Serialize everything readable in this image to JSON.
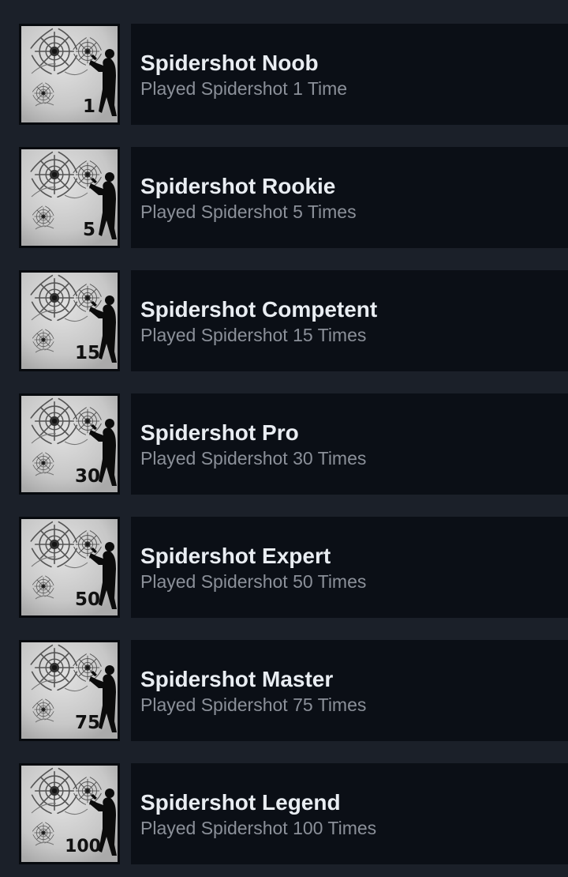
{
  "achievements": [
    {
      "title": "Spidershot Noob",
      "description": "Played Spidershot 1 Time",
      "badge_number": "1",
      "icon": "spidershot-achievement-icon"
    },
    {
      "title": "Spidershot Rookie",
      "description": "Played Spidershot 5 Times",
      "badge_number": "5",
      "icon": "spidershot-achievement-icon"
    },
    {
      "title": "Spidershot Competent",
      "description": "Played Spidershot 15 Times",
      "badge_number": "15",
      "icon": "spidershot-achievement-icon"
    },
    {
      "title": "Spidershot Pro",
      "description": "Played Spidershot 30 Times",
      "badge_number": "30",
      "icon": "spidershot-achievement-icon"
    },
    {
      "title": "Spidershot Expert",
      "description": "Played Spidershot 50 Times",
      "badge_number": "50",
      "icon": "spidershot-achievement-icon"
    },
    {
      "title": "Spidershot Master",
      "description": "Played Spidershot 75 Times",
      "badge_number": "75",
      "icon": "spidershot-achievement-icon"
    },
    {
      "title": "Spidershot Legend",
      "description": "Played Spidershot 100 Times",
      "badge_number": "100",
      "icon": "spidershot-achievement-icon"
    }
  ],
  "colors": {
    "background": "#1b2029",
    "panel": "#0b0f16",
    "title": "#e9edf2",
    "description": "#8b9099",
    "icon_background": "#c9c9c9"
  }
}
